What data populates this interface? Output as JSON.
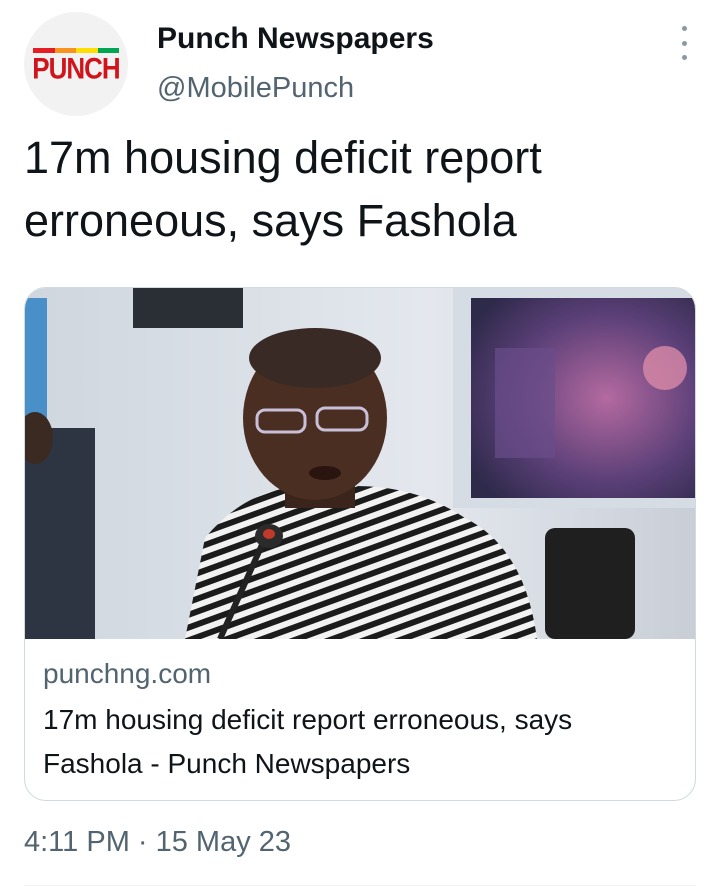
{
  "account": {
    "avatar_logo_text": "PUNCH",
    "name": "Punch Newspapers",
    "handle": "@MobilePunch"
  },
  "tweet": {
    "text": "17m housing deficit report erroneous, says Fashola"
  },
  "link_card": {
    "image_description": "Man in striped black-and-white attire speaking into a microphone",
    "domain": "punchng.com",
    "title": "17m housing deficit report erroneous, says Fashola - Punch Newspapers"
  },
  "timestamp": "4:11 PM · 15 May 23",
  "colors": {
    "brand_red": "#d0141b",
    "text_primary": "#0f1419",
    "text_secondary": "#536471",
    "border": "#cfd9de"
  },
  "icons": {
    "more": "more-vertical-icon"
  }
}
